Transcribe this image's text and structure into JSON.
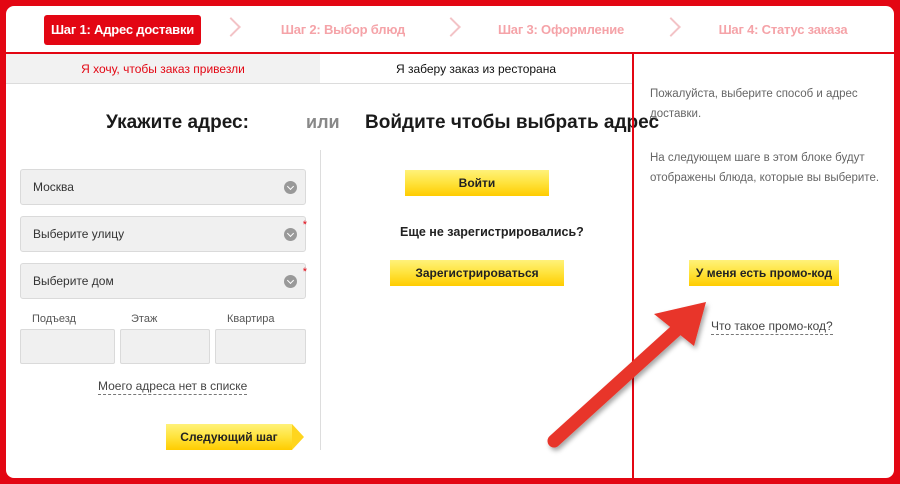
{
  "steps": [
    {
      "label": "Шаг 1: Адрес доставки",
      "active": true
    },
    {
      "label": "Шаг 2: Выбор блюд",
      "active": false
    },
    {
      "label": "Шаг 3: Оформление",
      "active": false
    },
    {
      "label": "Шаг 4: Статус заказа",
      "active": false
    }
  ],
  "tabs": {
    "delivery": "Я хочу, чтобы заказ привезли",
    "pickup": "Я заберу заказ из ресторана"
  },
  "address": {
    "heading": "Укажите адрес:",
    "or": "или",
    "city": "Москва",
    "street_placeholder": "Выберите улицу",
    "house_placeholder": "Выберите дом",
    "required_mark": "*",
    "entrance_label": "Подъезд",
    "floor_label": "Этаж",
    "apartment_label": "Квартира",
    "not_in_list": "Моего адреса нет в списке",
    "next_button": "Следующий шаг"
  },
  "login": {
    "heading": "Войдите чтобы выбрать адрес",
    "login_button": "Войти",
    "not_registered": "Еще не зарегистрировались?",
    "register_button": "Зарегистрироваться"
  },
  "side": {
    "hint1": "Пожалуйста, выберите способ и адрес доставки.",
    "hint2": "На следующем шаге в этом блоке будут отображены блюда, которые вы выберите.",
    "promo_button": "У меня есть промо-код",
    "promo_link": "Что такое промо-код?"
  },
  "colors": {
    "brand_red": "#e30613",
    "button_yellow": "#ffd51e",
    "annotation_arrow": "#e8342a"
  }
}
